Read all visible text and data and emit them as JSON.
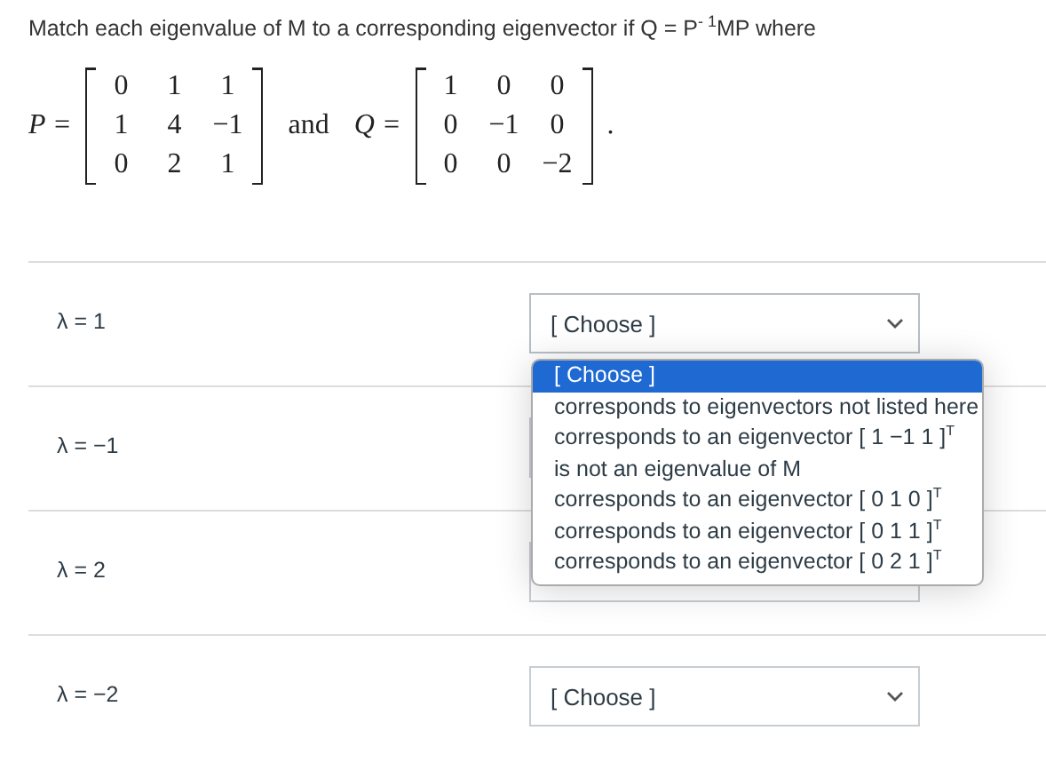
{
  "question": "Match each eigenvalue of M to a corresponding eigenvector if Q = P$^{- 1}$MP where",
  "equation": {
    "p_label": "P =",
    "p_matrix": [
      [
        "0",
        "1",
        "1"
      ],
      [
        "1",
        "4",
        "−1"
      ],
      [
        "0",
        "2",
        "1"
      ]
    ],
    "connector": "and",
    "q_label": "Q =",
    "q_matrix": [
      [
        "1",
        "0",
        "0"
      ],
      [
        "0",
        "−1",
        "0"
      ],
      [
        "0",
        "0",
        "−2"
      ]
    ],
    "end": "."
  },
  "rows": [
    {
      "label": "λ = 1",
      "dropdown": {
        "value": "[ Choose ]",
        "open": true,
        "options": [
          {
            "text": "[ Choose ]",
            "selected": true
          },
          {
            "text": "corresponds to eigenvectors not listed here",
            "selected": false
          },
          {
            "text": "corresponds to an eigenvector [ 1 −1 1 ]$^{T}$",
            "selected": false
          },
          {
            "text": "is not an eigenvalue of M",
            "selected": false
          },
          {
            "text": "corresponds to an eigenvector [ 0 1 0 ]$^{T}$",
            "selected": false
          },
          {
            "text": "corresponds to an eigenvector [ 0 1 1 ]$^{T}$",
            "selected": false
          },
          {
            "text": "corresponds to an eigenvector [ 0 2 1 ]$^{T}$",
            "selected": false
          }
        ]
      }
    },
    {
      "label": "λ = −1",
      "dropdown": {}
    },
    {
      "label": "λ = 2",
      "dropdown": {}
    },
    {
      "label": "λ = −2",
      "dropdown": {
        "value": "[ Choose ]"
      }
    }
  ]
}
